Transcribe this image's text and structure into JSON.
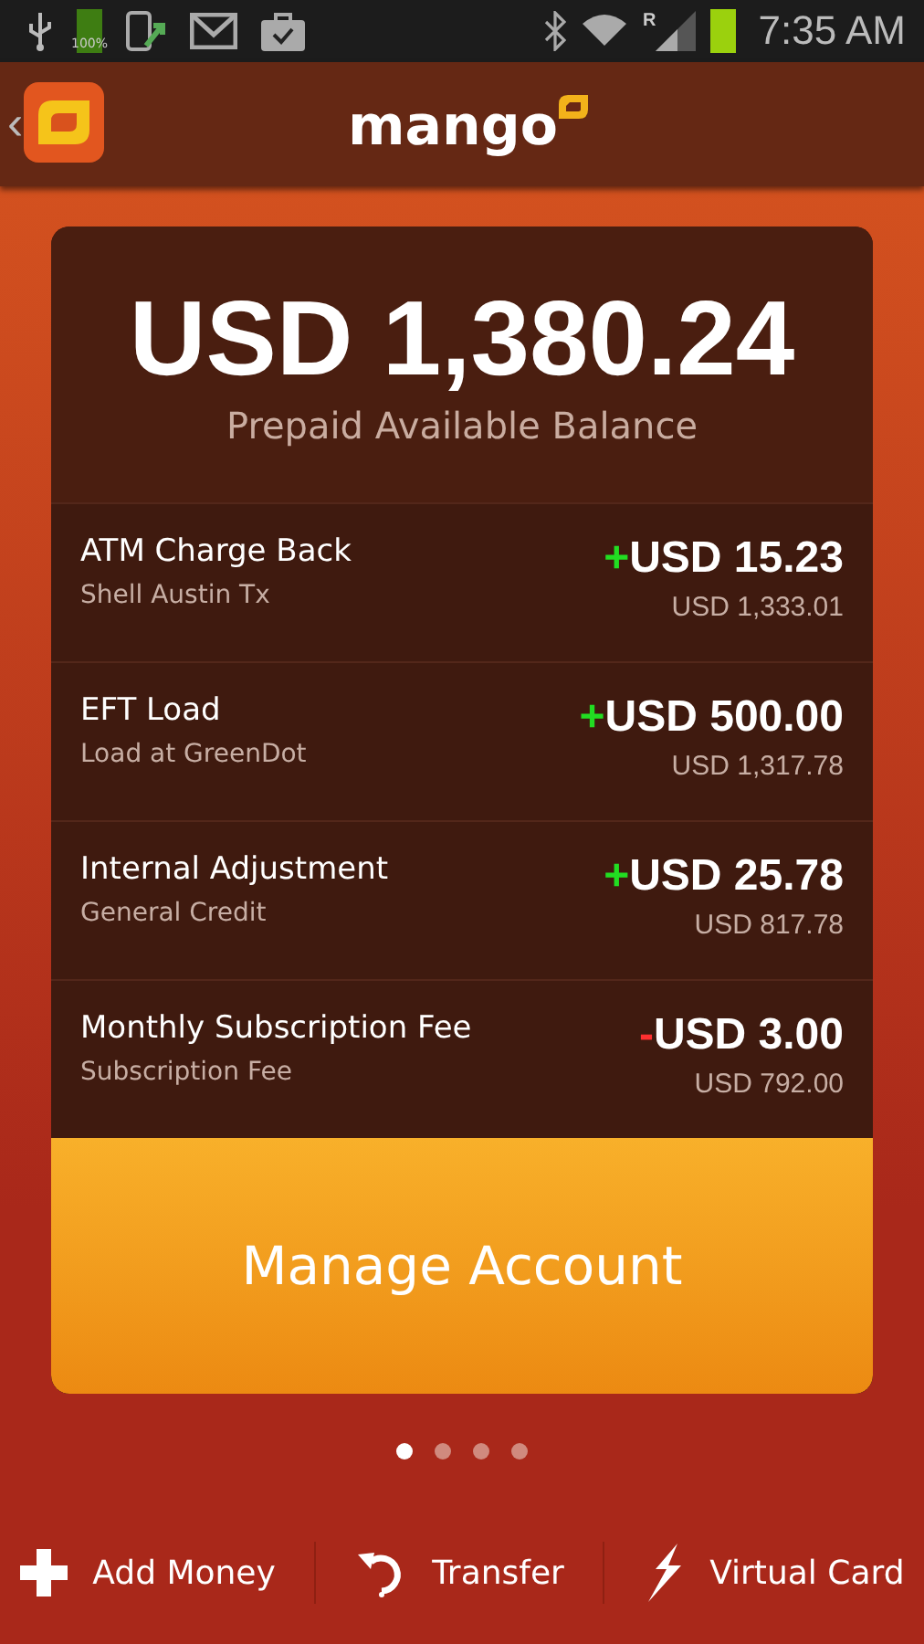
{
  "status_bar": {
    "battery_label": "100%",
    "time": "7:35 AM",
    "signal_label": "R"
  },
  "app_bar": {
    "back": "‹",
    "title": "mango"
  },
  "balance": {
    "amount": "USD 1,380.24",
    "label": "Prepaid Available Balance"
  },
  "transactions": [
    {
      "title": "ATM Charge Back",
      "subtitle": "Shell Austin Tx",
      "kind": "credit",
      "sign": "+",
      "amount": "USD 15.23",
      "running_balance": "USD 1,333.01"
    },
    {
      "title": "EFT Load",
      "subtitle": "Load at GreenDot",
      "kind": "credit",
      "sign": "+",
      "amount": "USD 500.00",
      "running_balance": "USD 1,317.78"
    },
    {
      "title": "Internal Adjustment",
      "subtitle": "General Credit",
      "kind": "credit",
      "sign": "+",
      "amount": "USD 25.78",
      "running_balance": "USD 817.78"
    },
    {
      "title": "Monthly Subscription Fee",
      "subtitle": "Subscription Fee",
      "kind": "debit",
      "sign": "-",
      "amount": "USD 3.00",
      "running_balance": "USD 792.00"
    }
  ],
  "primary_button": "Manage Account",
  "pages": [
    {
      "selected": true
    },
    {
      "selected": false
    },
    {
      "selected": false
    },
    {
      "selected": false
    }
  ],
  "actions": [
    {
      "kind": "add",
      "label": "Add Money"
    },
    {
      "kind": "transfer",
      "label": "Transfer"
    },
    {
      "kind": "virtual_card",
      "label": "Virtual Card"
    }
  ]
}
